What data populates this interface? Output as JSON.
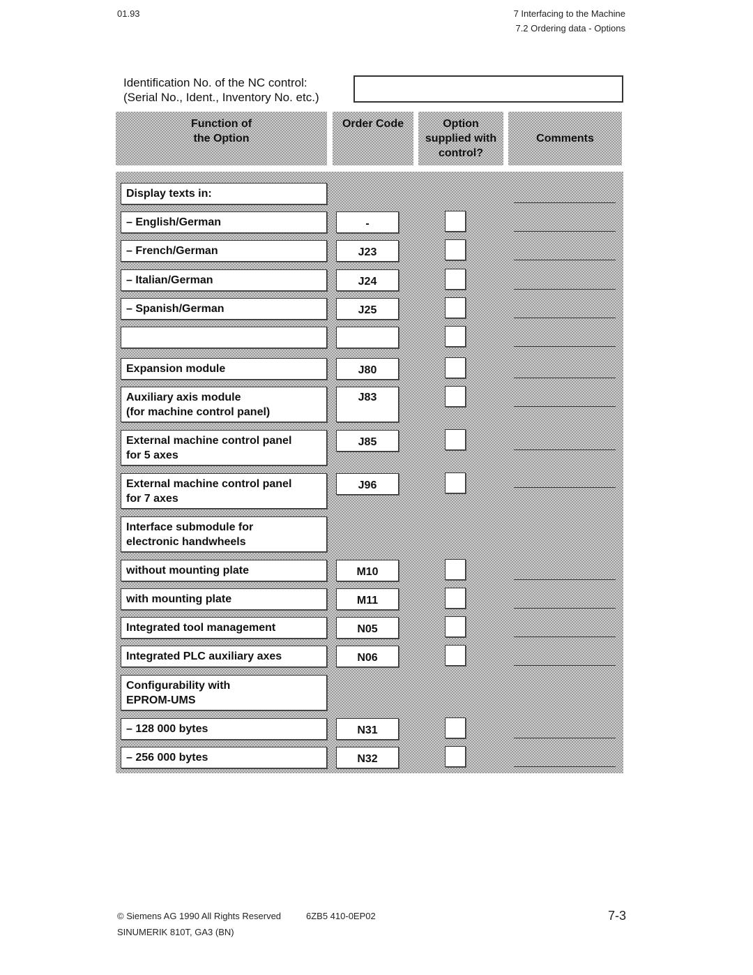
{
  "header": {
    "date": "01.93",
    "chapter": "7  Interfacing to the Machine",
    "section": "7.2  Ordering data - Options"
  },
  "identification": {
    "line1": "Identification No. of the NC control:",
    "line2": "(Serial No., Ident., Inventory No. etc.)",
    "value": ""
  },
  "columns": {
    "function": [
      "Function of",
      "the Option"
    ],
    "order_code": [
      "Order Code"
    ],
    "supplied": [
      "Option",
      "supplied with",
      "control?"
    ],
    "comments": [
      "Comments"
    ]
  },
  "rows": [
    {
      "function": [
        "Display texts in:"
      ],
      "code": null,
      "checkbox": false,
      "comment_line": true
    },
    {
      "function": [
        "–  English/German"
      ],
      "code": "-",
      "checkbox": true,
      "comment_line": true
    },
    {
      "function": [
        "–  French/German"
      ],
      "code": "J23",
      "checkbox": true,
      "comment_line": true
    },
    {
      "function": [
        "– Italian/German"
      ],
      "code": "J24",
      "checkbox": true,
      "comment_line": true
    },
    {
      "function": [
        "– Spanish/German"
      ],
      "code": "J25",
      "checkbox": true,
      "comment_line": true
    },
    {
      "function": [
        ""
      ],
      "code": "",
      "checkbox": true,
      "comment_line": true
    },
    {
      "function": [
        "Expansion module"
      ],
      "code": "J80",
      "checkbox": true,
      "comment_line": true
    },
    {
      "function": [
        "Auxiliary axis module",
        "(for machine control panel)"
      ],
      "code": "J83",
      "checkbox": true,
      "comment_line": true
    },
    {
      "function": [
        "External machine control panel",
        "for 5 axes"
      ],
      "code": "J85",
      "checkbox": true,
      "comment_line": true
    },
    {
      "function": [
        "External machine control panel",
        "for 7 axes"
      ],
      "code": "J96",
      "checkbox": true,
      "comment_line": true
    },
    {
      "function": [
        "Interface submodule for",
        "electronic handwheels"
      ],
      "code": null,
      "checkbox": false,
      "comment_line": false
    },
    {
      "function": [
        "without mounting plate"
      ],
      "code": "M10",
      "checkbox": true,
      "comment_line": true
    },
    {
      "function": [
        "with mounting plate"
      ],
      "code": "M11",
      "checkbox": true,
      "comment_line": true
    },
    {
      "function": [
        "Integrated tool management"
      ],
      "code": "N05",
      "checkbox": true,
      "comment_line": true
    },
    {
      "function": [
        "Integrated PLC auxiliary axes"
      ],
      "code": "N06",
      "checkbox": true,
      "comment_line": true
    },
    {
      "function": [
        "Configurability with",
        "EPROM-UMS"
      ],
      "code": null,
      "checkbox": false,
      "comment_line": false
    },
    {
      "function": [
        "–  128 000 bytes"
      ],
      "code": "N31",
      "checkbox": true,
      "comment_line": true
    },
    {
      "function": [
        "–  256 000 bytes"
      ],
      "code": "N32",
      "checkbox": true,
      "comment_line": true
    }
  ],
  "footer": {
    "copyright": "© Siemens AG 1990 All Rights Reserved",
    "order_no": "6ZB5 410-0EP02",
    "product": "SINUMERIK 810T, GA3 (BN)",
    "page": "7-3"
  }
}
